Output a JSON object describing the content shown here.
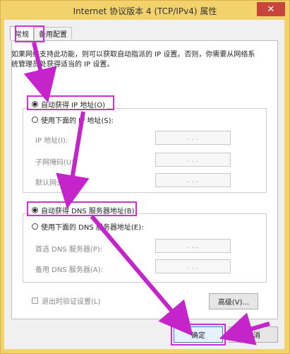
{
  "window": {
    "title": "Internet 协议版本 4 (TCP/IPv4) 属性",
    "close_glyph": "✕"
  },
  "tabs": [
    {
      "label": "常规"
    },
    {
      "label": "备用配置"
    }
  ],
  "description": "如果网络支持此功能，则可以获取自动指派的 IP 设置。否则，你需要从网络系统管理员处获得适当的 IP 设置。",
  "ip": {
    "auto_label": "自动获得 IP 地址(O)",
    "manual_label": "使用下面的 IP 地址(S):",
    "fields": [
      {
        "label": "IP 地址(I):",
        "value": ".    .    ."
      },
      {
        "label": "子网掩码(U):",
        "value": ".    .    ."
      },
      {
        "label": "默认网关(D):",
        "value": ".    .    ."
      }
    ]
  },
  "dns": {
    "auto_label": "自动获得 DNS 服务器地址(B)",
    "manual_label": "使用下面的 DNS 服务器地址(E):",
    "fields": [
      {
        "label": "首选 DNS 服务器(P):",
        "value": ".    .    ."
      },
      {
        "label": "备用 DNS 服务器(A):",
        "value": ".    .    ."
      }
    ]
  },
  "validate_label": "退出时验证设置(L)",
  "advanced_label": "高级(V)...",
  "ok_label": "确定",
  "cancel_label": "取消",
  "colors": {
    "highlight": "#d02fd6",
    "titlebar": "#f3d26b",
    "close": "#c7463b"
  }
}
